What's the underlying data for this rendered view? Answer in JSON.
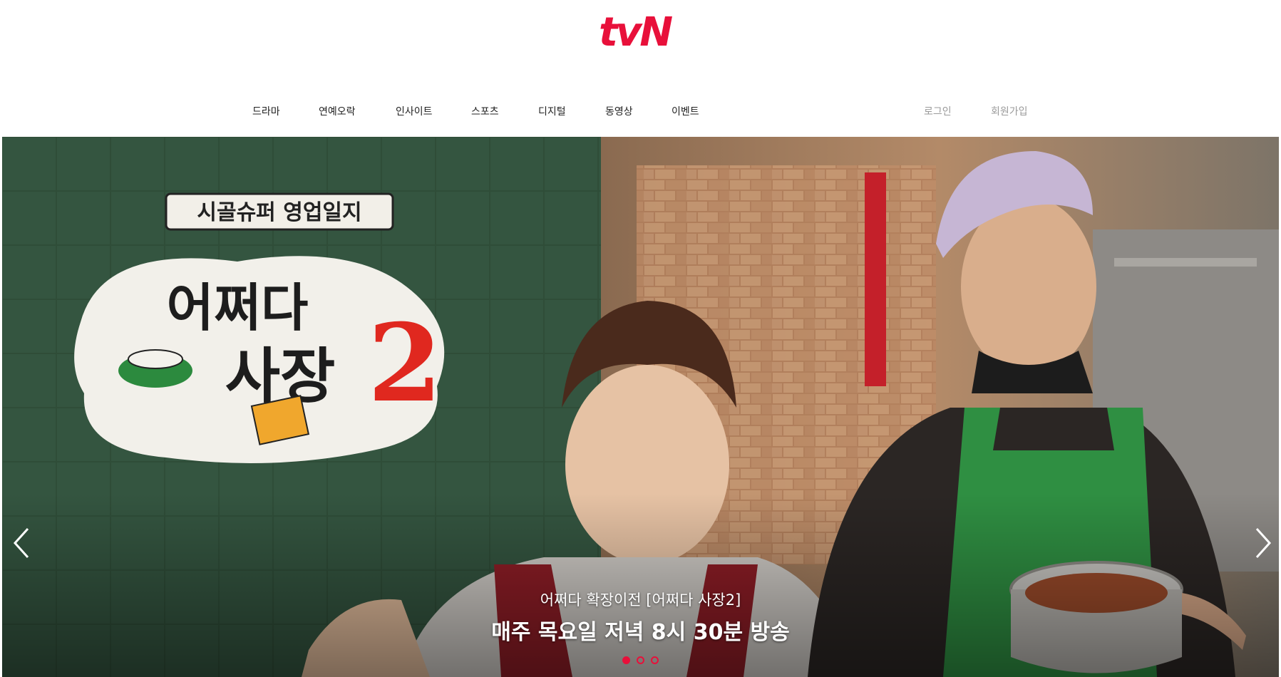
{
  "header": {
    "logo_text": "tvN",
    "brand_color": "#e8103a"
  },
  "gnb": [
    {
      "label": "드라마"
    },
    {
      "label": "연예오락"
    },
    {
      "label": "인사이트"
    },
    {
      "label": "스포츠"
    },
    {
      "label": "디지털"
    },
    {
      "label": "동영상"
    },
    {
      "label": "이벤트"
    }
  ],
  "util": {
    "login": "로그인",
    "signup": "회원가입"
  },
  "hero": {
    "badge_text": "시골슈퍼 영업일지",
    "title_line1": "어쩌다",
    "title_line2": "사장",
    "title_number": "2",
    "caption_sub": "어쩌다 확장이전 [어쩌다 사장2]",
    "caption_main": "매주 목요일 저녁 8시 30분 방송",
    "prev_icon": "chevron-left-icon",
    "next_icon": "chevron-right-icon",
    "slides_total": 3,
    "slide_active": 1
  }
}
